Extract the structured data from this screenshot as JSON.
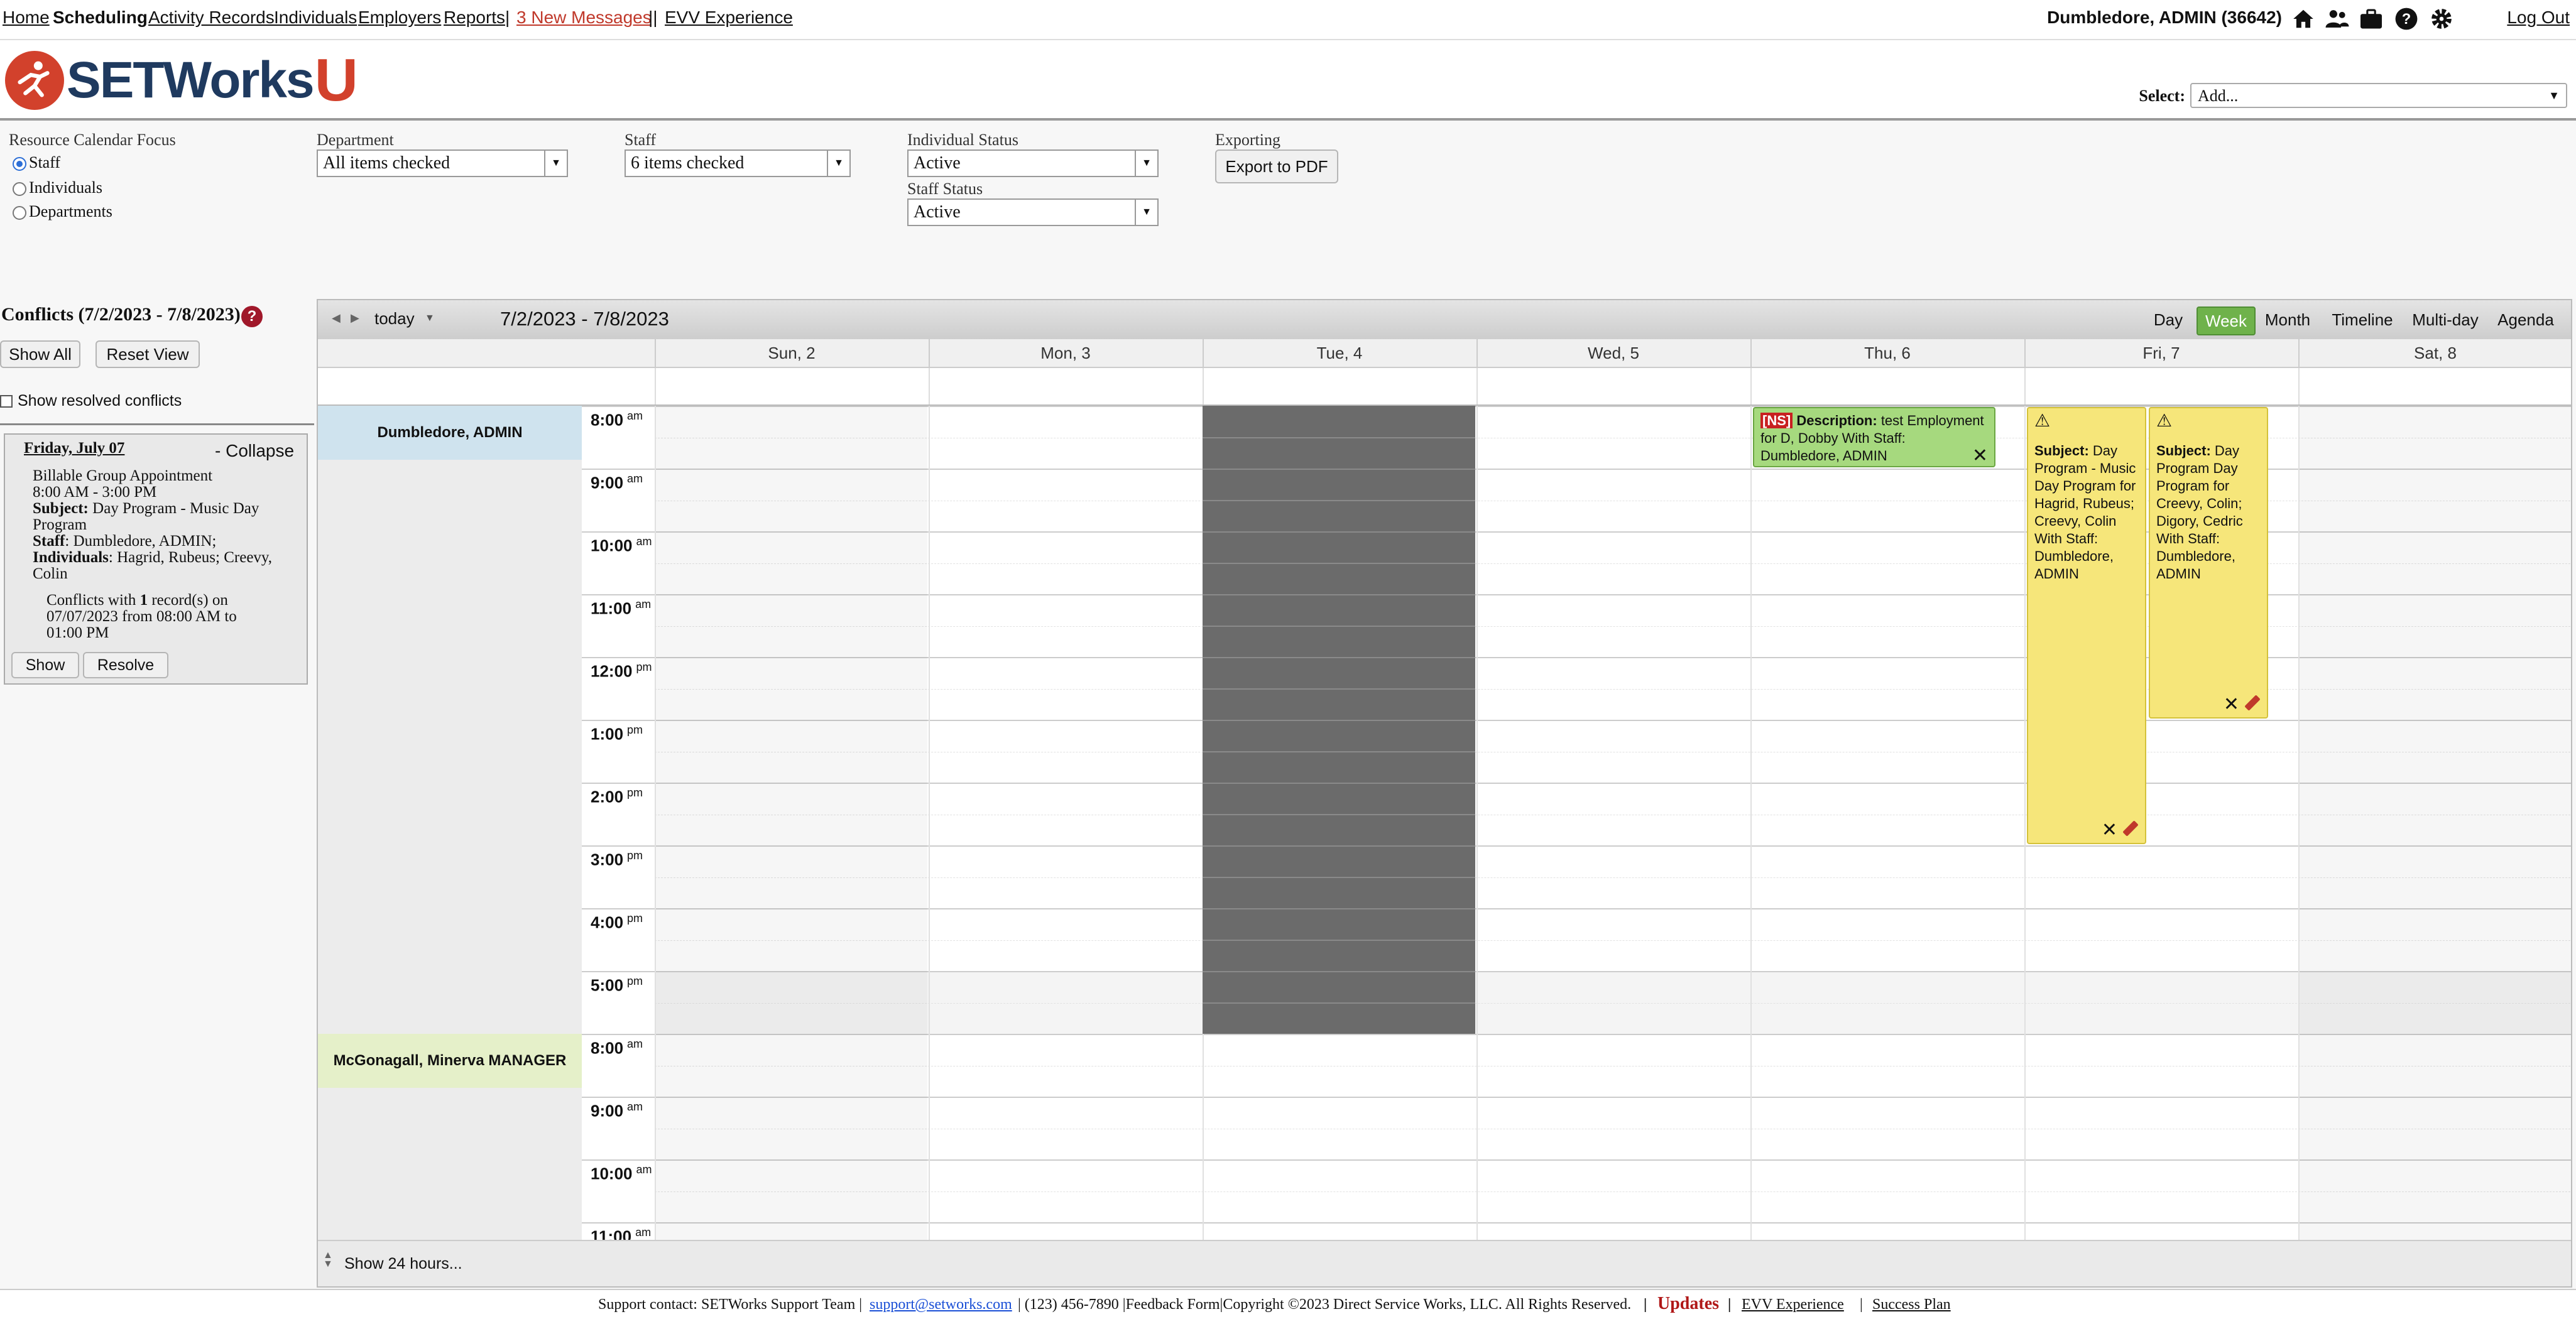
{
  "nav": {
    "items": [
      "Home",
      "Scheduling",
      "Activity Records",
      "Individuals",
      "Employers",
      "Reports",
      "3 New Messages",
      "EVV Experience"
    ],
    "separators": [
      "|",
      "||"
    ],
    "user": "Dumbledore, ADMIN  (36642)",
    "logout": "Log Out",
    "icons": [
      "home-icon",
      "people-icon",
      "briefcase-icon",
      "help-icon",
      "gear-icon"
    ],
    "message_color": "#c0392b"
  },
  "header": {
    "logo_main": "SETWorks",
    "logo_u": "U",
    "select_label": "Select:",
    "select_value": "Add..."
  },
  "filters": {
    "focus_label": "Resource Calendar Focus",
    "focus_options": [
      "Staff",
      "Individuals",
      "Departments"
    ],
    "focus_selected": "Staff",
    "department_label": "Department",
    "department_value": "All items checked",
    "staff_label": "Staff",
    "staff_value": "6 items checked",
    "individual_status_label": "Individual Status",
    "individual_status_value": "Active",
    "staff_status_label": "Staff Status",
    "staff_status_value": "Active",
    "exporting_label": "Exporting",
    "export_button": "Export to PDF"
  },
  "conflicts": {
    "title": "Conflicts (7/2/2023 - 7/8/2023)",
    "help": "?",
    "show_all": "Show All",
    "reset_view": "Reset View",
    "show_resolved": "Show resolved conflicts",
    "card": {
      "date": "Friday, July 07",
      "collapse": "- Collapse",
      "type": "Billable Group Appointment",
      "time": "8:00 AM - 3:00 PM",
      "subject_label": "Subject:",
      "subject": "Day Program - Music Day",
      "subject_cont": "Program",
      "staff_label": "Staff",
      "staff": ": Dumbledore, ADMIN;",
      "individuals_label": "Individuals",
      "individuals": ": Hagrid, Rubeus; Creevy,",
      "individuals_cont": "Colin",
      "conflict_text_1": "Conflicts with ",
      "conflict_count": "1",
      "conflict_text_2": " record(s) on",
      "conflict_text_3": "07/07/2023 from 08:00 AM to",
      "conflict_text_4": "01:00 PM",
      "show": "Show",
      "resolve": "Resolve"
    }
  },
  "calendar": {
    "today": "today",
    "range": "7/2/2023 - 7/8/2023",
    "views": [
      "Day",
      "Week",
      "Month",
      "Timeline",
      "Multi-day",
      "Agenda"
    ],
    "active_view": "Week",
    "active_color": "#6fb24b",
    "days": [
      "Sun, 2",
      "Mon, 3",
      "Tue, 4",
      "Wed, 5",
      "Thu, 6",
      "Fri, 7",
      "Sat, 8"
    ],
    "resources": [
      "Dumbledore, ADMIN",
      "McGonagall, Minerva MANAGER"
    ],
    "resource_colors": [
      "#cfe3ee",
      "#e5f0c9"
    ],
    "hours": [
      {
        "h": "8:00",
        "ap": "am"
      },
      {
        "h": "9:00",
        "ap": "am"
      },
      {
        "h": "10:00",
        "ap": "am"
      },
      {
        "h": "11:00",
        "ap": "am"
      },
      {
        "h": "12:00",
        "ap": "pm"
      },
      {
        "h": "1:00",
        "ap": "pm"
      },
      {
        "h": "2:00",
        "ap": "pm"
      },
      {
        "h": "3:00",
        "ap": "pm"
      },
      {
        "h": "4:00",
        "ap": "pm"
      },
      {
        "h": "5:00",
        "ap": "pm"
      }
    ],
    "hours2": [
      {
        "h": "8:00",
        "ap": "am"
      },
      {
        "h": "9:00",
        "ap": "am"
      },
      {
        "h": "10:00",
        "ap": "am"
      },
      {
        "h": "11:00",
        "ap": "am"
      }
    ],
    "events": {
      "thu": {
        "tag": "[NS]",
        "label": "Description:",
        "text": " test Employment for D, Dobby With Staff: Dumbledore, ADMIN"
      },
      "fri1": {
        "label": "Subject:",
        "text": " Day Program - Music Day Program for Hagrid, Rubeus; Creevy, Colin With Staff: Dumbledore, ADMIN"
      },
      "fri2": {
        "label": "Subject:",
        "text": " Day Program Day Program for Creevy, Colin; Digory, Cedric With Staff: Dumbledore, ADMIN"
      }
    },
    "show_24": "Show 24 hours..."
  },
  "footer": {
    "support": "Support contact: SETWorks Support Team |",
    "email": "support@setworks.com",
    "rest": "| (123) 456-7890 |Feedback Form|Copyright ©2023 Direct Service Works, LLC. All Rights Reserved.",
    "updates": "Updates",
    "evv": "EVV Experience",
    "success": "Success Plan",
    "sep": "|"
  }
}
